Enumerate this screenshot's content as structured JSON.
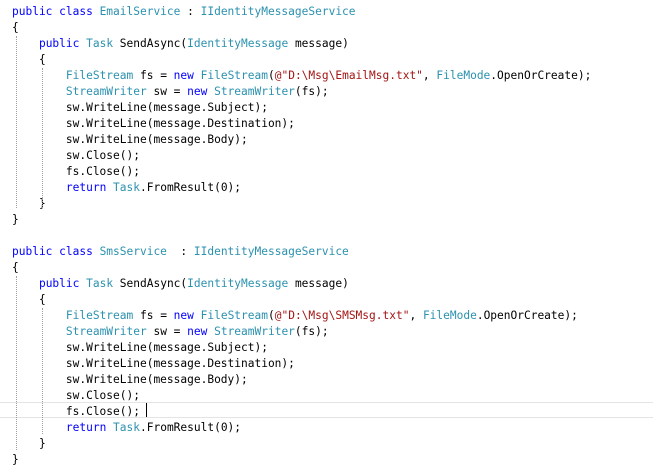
{
  "editor": {
    "lines": [
      [
        {
          "t": "public class ",
          "c": "kw"
        },
        {
          "t": "EmailService",
          "c": "type"
        },
        {
          "t": " : ",
          "c": "plain"
        },
        {
          "t": "IIdentityMessageService",
          "c": "type"
        }
      ],
      [
        {
          "t": "{",
          "c": "plain"
        }
      ],
      [
        {
          "t": "    ",
          "c": "plain"
        },
        {
          "t": "public ",
          "c": "kw"
        },
        {
          "t": "Task",
          "c": "type"
        },
        {
          "t": " SendAsync(",
          "c": "plain"
        },
        {
          "t": "IdentityMessage",
          "c": "type"
        },
        {
          "t": " message)",
          "c": "plain"
        }
      ],
      [
        {
          "t": "    {",
          "c": "plain"
        }
      ],
      [
        {
          "t": "        ",
          "c": "plain"
        },
        {
          "t": "FileStream",
          "c": "type"
        },
        {
          "t": " fs = ",
          "c": "plain"
        },
        {
          "t": "new ",
          "c": "kw"
        },
        {
          "t": "FileStream",
          "c": "type"
        },
        {
          "t": "(",
          "c": "plain"
        },
        {
          "t": "@\"D:\\Msg\\EmailMsg.txt\"",
          "c": "str"
        },
        {
          "t": ", ",
          "c": "plain"
        },
        {
          "t": "FileMode",
          "c": "type"
        },
        {
          "t": ".OpenOrCreate);",
          "c": "plain"
        }
      ],
      [
        {
          "t": "        ",
          "c": "plain"
        },
        {
          "t": "StreamWriter",
          "c": "type"
        },
        {
          "t": " sw = ",
          "c": "plain"
        },
        {
          "t": "new ",
          "c": "kw"
        },
        {
          "t": "StreamWriter",
          "c": "type"
        },
        {
          "t": "(fs);",
          "c": "plain"
        }
      ],
      [
        {
          "t": "        sw.WriteLine(message.Subject);",
          "c": "plain"
        }
      ],
      [
        {
          "t": "        sw.WriteLine(message.Destination);",
          "c": "plain"
        }
      ],
      [
        {
          "t": "        sw.WriteLine(message.Body);",
          "c": "plain"
        }
      ],
      [
        {
          "t": "        sw.Close();",
          "c": "plain"
        }
      ],
      [
        {
          "t": "        fs.Close();",
          "c": "plain"
        }
      ],
      [
        {
          "t": "        ",
          "c": "plain"
        },
        {
          "t": "return ",
          "c": "kw"
        },
        {
          "t": "Task",
          "c": "type"
        },
        {
          "t": ".FromResult(0);",
          "c": "plain"
        }
      ],
      [
        {
          "t": "    }",
          "c": "plain"
        }
      ],
      [
        {
          "t": "}",
          "c": "plain"
        }
      ],
      [],
      [
        {
          "t": "public class ",
          "c": "kw"
        },
        {
          "t": "SmsService",
          "c": "type"
        },
        {
          "t": "  : ",
          "c": "plain"
        },
        {
          "t": "IIdentityMessageService",
          "c": "type"
        }
      ],
      [
        {
          "t": "{",
          "c": "plain"
        }
      ],
      [
        {
          "t": "    ",
          "c": "plain"
        },
        {
          "t": "public ",
          "c": "kw"
        },
        {
          "t": "Task",
          "c": "type"
        },
        {
          "t": " SendAsync(",
          "c": "plain"
        },
        {
          "t": "IdentityMessage",
          "c": "type"
        },
        {
          "t": " message)",
          "c": "plain"
        }
      ],
      [
        {
          "t": "    {",
          "c": "plain"
        }
      ],
      [
        {
          "t": "        ",
          "c": "plain"
        },
        {
          "t": "FileStream",
          "c": "type"
        },
        {
          "t": " fs = ",
          "c": "plain"
        },
        {
          "t": "new ",
          "c": "kw"
        },
        {
          "t": "FileStream",
          "c": "type"
        },
        {
          "t": "(",
          "c": "plain"
        },
        {
          "t": "@\"D:\\Msg\\SMSMsg.txt\"",
          "c": "str"
        },
        {
          "t": ", ",
          "c": "plain"
        },
        {
          "t": "FileMode",
          "c": "type"
        },
        {
          "t": ".OpenOrCreate);",
          "c": "plain"
        }
      ],
      [
        {
          "t": "        ",
          "c": "plain"
        },
        {
          "t": "StreamWriter",
          "c": "type"
        },
        {
          "t": " sw = ",
          "c": "plain"
        },
        {
          "t": "new ",
          "c": "kw"
        },
        {
          "t": "StreamWriter",
          "c": "type"
        },
        {
          "t": "(fs);",
          "c": "plain"
        }
      ],
      [
        {
          "t": "        sw.WriteLine(message.Subject);",
          "c": "plain"
        }
      ],
      [
        {
          "t": "        sw.WriteLine(message.Destination);",
          "c": "plain"
        }
      ],
      [
        {
          "t": "        sw.WriteLine(message.Body);",
          "c": "plain"
        }
      ],
      [
        {
          "t": "        sw.Close();",
          "c": "plain"
        }
      ],
      [
        {
          "t": "        fs.Close();",
          "c": "plain"
        }
      ],
      [
        {
          "t": "        ",
          "c": "plain"
        },
        {
          "t": "return ",
          "c": "kw"
        },
        {
          "t": "Task",
          "c": "type"
        },
        {
          "t": ".FromResult(0);",
          "c": "plain"
        }
      ],
      [
        {
          "t": "    }",
          "c": "plain"
        }
      ],
      [
        {
          "t": "}",
          "c": "plain"
        }
      ]
    ]
  },
  "colors": {
    "keyword": "#0000ff",
    "type": "#2b91af",
    "string": "#a31515",
    "plain": "#000000",
    "background": "#ffffff"
  }
}
